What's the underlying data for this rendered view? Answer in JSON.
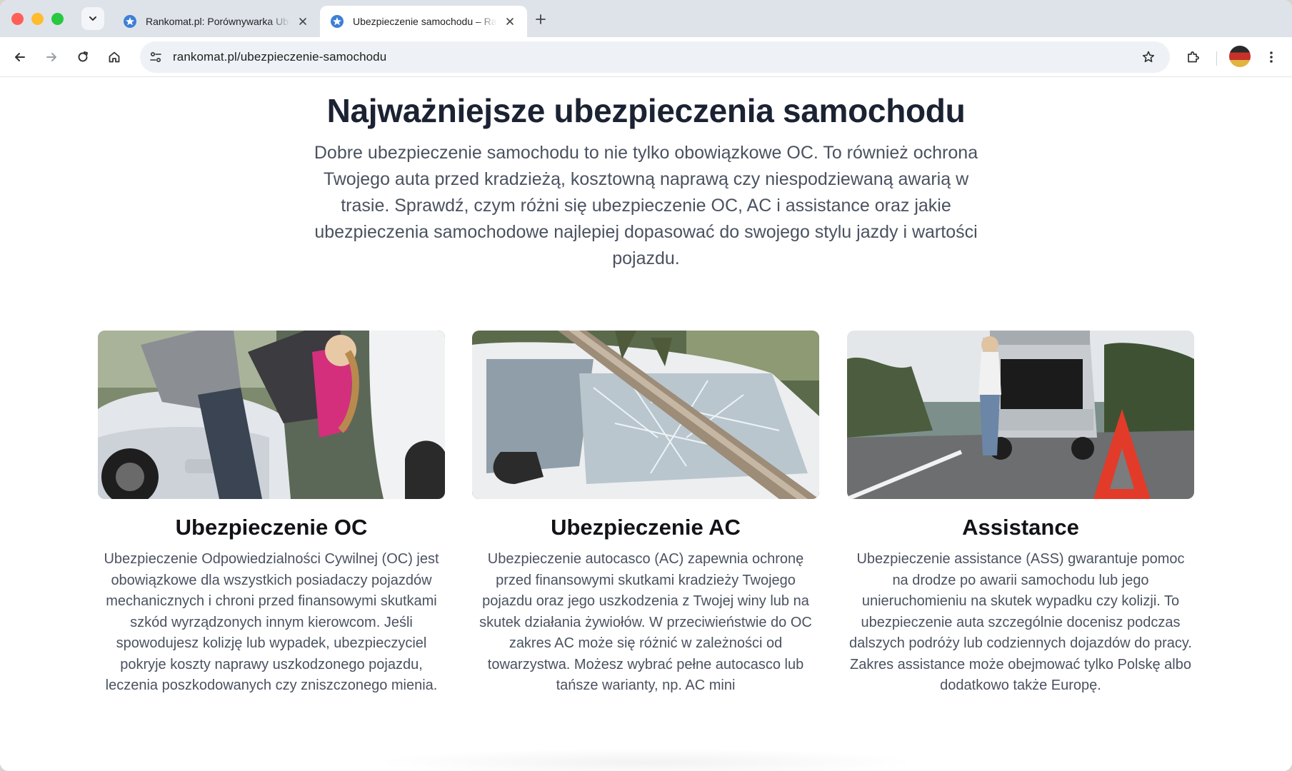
{
  "browser": {
    "tabs": [
      {
        "title": "Rankomat.pl: Porównywarka Ubezpieczeń",
        "active": false,
        "favicon": "rankomat-star-icon"
      },
      {
        "title": "Ubezpieczenie samochodu – Rankomat",
        "active": true,
        "favicon": "rankomat-star-icon"
      }
    ],
    "url_domain": "rankomat.pl",
    "url_path": "/ubezpieczenie-samochodu",
    "accent_color": "#3d7fd6"
  },
  "page": {
    "heading": "Najważniejsze ubezpieczenia samochodu",
    "lead": "Dobre ubezpieczenie samochodu to nie tylko obowiązkowe OC. To również ochrona Twojego auta przed kradzieżą, kosztowną naprawą czy niespodziewaną awarią w trasie. Sprawdź, czym różni się ubezpieczenie OC, AC i assistance oraz jakie ubezpieczenia samochodowe najlepiej dopasować do swojego stylu jazdy i wartości pojazdu.",
    "cards": [
      {
        "title": "Ubezpieczenie OC",
        "text": "Ubezpieczenie Odpowiedzialności Cywilnej (OC) jest obowiązkowe dla wszystkich posiadaczy pojazdów mechanicznych i chroni przed finansowymi skutkami szkód wyrządzonych innym kierowcom. Jeśli spowodujesz kolizję lub wypadek, ubezpieczyciel pokryje koszty naprawy uszkodzonego pojazdu, leczenia poszkodowanych czy zniszczonego mienia."
      },
      {
        "title": "Ubezpieczenie AC",
        "text": "Ubezpieczenie autocasco (AC) zapewnia ochronę przed finansowymi skutkami kradzieży Twojego pojazdu oraz jego uszkodzenia z Twojej winy lub na skutek działania żywiołów. W przeciwieństwie do OC zakres AC może się różnić w zależności od towarzystwa. Możesz wybrać pełne autocasco lub tańsze warianty, np. AC mini"
      },
      {
        "title": "Assistance",
        "text": "Ubezpieczenie assistance (ASS) gwarantuje pomoc na drodze po awarii samochodu lub jego unieruchomieniu na skutek wypadku czy kolizji. To ubezpieczenie auta szczególnie docenisz podczas dalszych podróży lub codziennych dojazdów do pracy. Zakres assistance może obejmować tylko Polskę albo dodatkowo także Europę."
      }
    ]
  }
}
